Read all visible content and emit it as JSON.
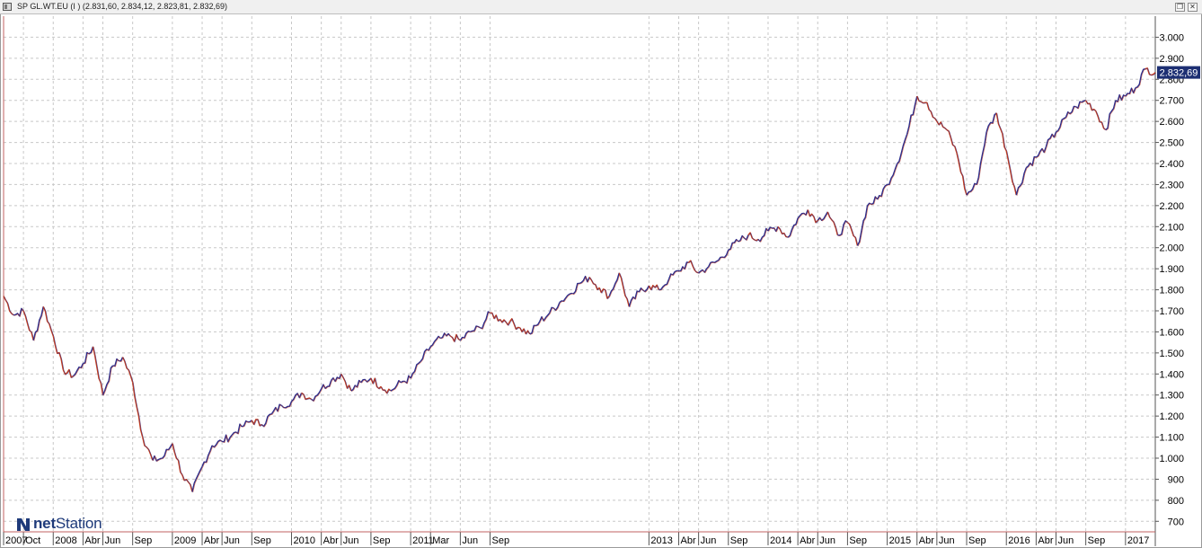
{
  "window": {
    "title": "SP GL.WT.EU (I ) (2.831,60, 2.834,12, 2.823,81, 2.832,69)",
    "buttons": [
      "restore",
      "close"
    ]
  },
  "logo": {
    "prefix": "net",
    "suffix": "Station"
  },
  "colors": {
    "up": "#2b2d8c",
    "down": "#c0391b",
    "last_label_bg": "#1d2f73",
    "grid": "#c8c8c8",
    "axis_line": "#c06060"
  },
  "chart_data": {
    "type": "line",
    "title": "",
    "xlabel": "",
    "ylabel": "",
    "ylim": [
      650,
      3100
    ],
    "y_ticks": [
      700,
      800,
      900,
      1000,
      1100,
      1200,
      1300,
      1400,
      1500,
      1600,
      1700,
      1800,
      1900,
      2000,
      2100,
      2200,
      2300,
      2400,
      2500,
      2600,
      2700,
      2800,
      2900,
      3000
    ],
    "y_tick_labels": [
      "700",
      "800",
      "900",
      "1.000",
      "1.100",
      "1.200",
      "1.300",
      "1.400",
      "1.500",
      "1.600",
      "1.700",
      "1.800",
      "1.900",
      "2.000",
      "2.100",
      "2.200",
      "2.300",
      "2.400",
      "2.500",
      "2.600",
      "2.700",
      "2.800",
      "2.900",
      "3.000"
    ],
    "x_range": [
      "2007-08",
      "2017-04"
    ],
    "x_ticks": [
      {
        "date": "2007-08",
        "label": "2007"
      },
      {
        "date": "2007-10",
        "label": "Oct"
      },
      {
        "date": "2008-01",
        "label": "2008"
      },
      {
        "date": "2008-04",
        "label": "Abr"
      },
      {
        "date": "2008-06",
        "label": "Jun"
      },
      {
        "date": "2008-09",
        "label": "Sep"
      },
      {
        "date": "2009-01",
        "label": "2009"
      },
      {
        "date": "2009-04",
        "label": "Abr"
      },
      {
        "date": "2009-06",
        "label": "Jun"
      },
      {
        "date": "2009-09",
        "label": "Sep"
      },
      {
        "date": "2010-01",
        "label": "2010"
      },
      {
        "date": "2010-04",
        "label": "Abr"
      },
      {
        "date": "2010-06",
        "label": "Jun"
      },
      {
        "date": "2010-09",
        "label": "Sep"
      },
      {
        "date": "2011-01",
        "label": "2011"
      },
      {
        "date": "2011-03",
        "label": "Mar"
      },
      {
        "date": "2011-06",
        "label": "Jun"
      },
      {
        "date": "2011-09",
        "label": "Sep"
      },
      {
        "date": "2013-01",
        "label": "2013"
      },
      {
        "date": "2013-04",
        "label": "Abr"
      },
      {
        "date": "2013-06",
        "label": "Jun"
      },
      {
        "date": "2013-09",
        "label": "Sep"
      },
      {
        "date": "2014-01",
        "label": "2014"
      },
      {
        "date": "2014-04",
        "label": "Abr"
      },
      {
        "date": "2014-06",
        "label": "Jun"
      },
      {
        "date": "2014-09",
        "label": "Sep"
      },
      {
        "date": "2015-01",
        "label": "2015"
      },
      {
        "date": "2015-04",
        "label": "Abr"
      },
      {
        "date": "2015-06",
        "label": "Jun"
      },
      {
        "date": "2015-09",
        "label": "Sep"
      },
      {
        "date": "2016-01",
        "label": "2016"
      },
      {
        "date": "2016-04",
        "label": "Abr"
      },
      {
        "date": "2016-06",
        "label": "Jun"
      },
      {
        "date": "2016-09",
        "label": "Sep"
      },
      {
        "date": "2017-01",
        "label": "2017"
      }
    ],
    "last_value": 2832.69,
    "last_value_label": "2.832,69",
    "grid": true,
    "series": [
      {
        "points": [
          [
            "2007-08",
            1770
          ],
          [
            "2007-09",
            1680
          ],
          [
            "2007-10",
            1700
          ],
          [
            "2007-11",
            1560
          ],
          [
            "2007-12",
            1720
          ],
          [
            "2008-01",
            1580
          ],
          [
            "2008-02",
            1420
          ],
          [
            "2008-03",
            1390
          ],
          [
            "2008-04",
            1450
          ],
          [
            "2008-05",
            1530
          ],
          [
            "2008-06",
            1300
          ],
          [
            "2008-07",
            1440
          ],
          [
            "2008-08",
            1480
          ],
          [
            "2008-09",
            1360
          ],
          [
            "2008-10",
            1100
          ],
          [
            "2008-11",
            990
          ],
          [
            "2008-12",
            1000
          ],
          [
            "2009-01",
            1070
          ],
          [
            "2009-02",
            920
          ],
          [
            "2009-03",
            840
          ],
          [
            "2009-04",
            960
          ],
          [
            "2009-05",
            1060
          ],
          [
            "2009-06",
            1080
          ],
          [
            "2009-07",
            1110
          ],
          [
            "2009-08",
            1150
          ],
          [
            "2009-09",
            1180
          ],
          [
            "2009-10",
            1160
          ],
          [
            "2009-11",
            1210
          ],
          [
            "2009-12",
            1250
          ],
          [
            "2010-01",
            1270
          ],
          [
            "2010-02",
            1310
          ],
          [
            "2010-03",
            1280
          ],
          [
            "2010-04",
            1330
          ],
          [
            "2010-05",
            1370
          ],
          [
            "2010-06",
            1400
          ],
          [
            "2010-07",
            1320
          ],
          [
            "2010-08",
            1360
          ],
          [
            "2010-09",
            1380
          ],
          [
            "2010-10",
            1340
          ],
          [
            "2010-11",
            1320
          ],
          [
            "2010-12",
            1360
          ],
          [
            "2011-01",
            1380
          ],
          [
            "2011-02",
            1460
          ],
          [
            "2011-03",
            1530
          ],
          [
            "2011-04",
            1570
          ],
          [
            "2011-05",
            1580
          ],
          [
            "2011-06",
            1560
          ],
          [
            "2011-07",
            1600
          ],
          [
            "2011-08",
            1620
          ],
          [
            "2011-09",
            1690
          ],
          [
            "2011-10",
            1660
          ],
          [
            "2011-11",
            1650
          ],
          [
            "2011-12",
            1620
          ],
          [
            "2012-01",
            1590
          ],
          [
            "2012-02",
            1650
          ],
          [
            "2012-03",
            1690
          ],
          [
            "2012-04",
            1740
          ],
          [
            "2012-05",
            1780
          ],
          [
            "2012-06",
            1830
          ],
          [
            "2012-07",
            1860
          ],
          [
            "2012-08",
            1810
          ],
          [
            "2012-09",
            1770
          ],
          [
            "2012-10",
            1880
          ],
          [
            "2012-11",
            1720
          ],
          [
            "2012-12",
            1790
          ],
          [
            "2013-01",
            1820
          ],
          [
            "2013-02",
            1800
          ],
          [
            "2013-03",
            1850
          ],
          [
            "2013-04",
            1890
          ],
          [
            "2013-05",
            1930
          ],
          [
            "2013-06",
            1880
          ],
          [
            "2013-07",
            1910
          ],
          [
            "2013-08",
            1940
          ],
          [
            "2013-09",
            1990
          ],
          [
            "2013-10",
            2030
          ],
          [
            "2013-11",
            2060
          ],
          [
            "2013-12",
            2040
          ],
          [
            "2014-01",
            2080
          ],
          [
            "2014-02",
            2100
          ],
          [
            "2014-03",
            2050
          ],
          [
            "2014-04",
            2140
          ],
          [
            "2014-05",
            2180
          ],
          [
            "2014-06",
            2130
          ],
          [
            "2014-07",
            2170
          ],
          [
            "2014-08",
            2060
          ],
          [
            "2014-09",
            2120
          ],
          [
            "2014-10",
            2010
          ],
          [
            "2014-11",
            2200
          ],
          [
            "2014-12",
            2230
          ],
          [
            "2015-01",
            2300
          ],
          [
            "2015-02",
            2400
          ],
          [
            "2015-03",
            2540
          ],
          [
            "2015-04",
            2720
          ],
          [
            "2015-05",
            2690
          ],
          [
            "2015-06",
            2600
          ],
          [
            "2015-07",
            2560
          ],
          [
            "2015-08",
            2450
          ],
          [
            "2015-09",
            2250
          ],
          [
            "2015-10",
            2300
          ],
          [
            "2015-11",
            2550
          ],
          [
            "2015-12",
            2640
          ],
          [
            "2016-01",
            2460
          ],
          [
            "2016-02",
            2250
          ],
          [
            "2016-03",
            2380
          ],
          [
            "2016-04",
            2430
          ],
          [
            "2016-05",
            2480
          ],
          [
            "2016-06",
            2550
          ],
          [
            "2016-07",
            2620
          ],
          [
            "2016-08",
            2670
          ],
          [
            "2016-09",
            2700
          ],
          [
            "2016-10",
            2650
          ],
          [
            "2016-11",
            2560
          ],
          [
            "2016-12",
            2700
          ],
          [
            "2017-01",
            2720
          ],
          [
            "2017-02",
            2760
          ],
          [
            "2017-03",
            2850
          ],
          [
            "2017-04",
            2833
          ]
        ]
      }
    ]
  }
}
